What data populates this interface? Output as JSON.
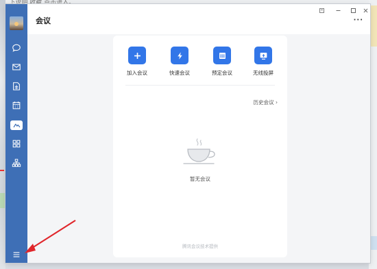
{
  "background": {
    "top_text": "...     下说明      收藏     点击进入。"
  },
  "window": {
    "title": "会议",
    "controls": {
      "pin_icon": "pin-icon",
      "minimize_icon": "minimize-icon",
      "maximize_icon": "maximize-icon",
      "close_icon": "close-icon"
    },
    "more_label": "···"
  },
  "sidebar": {
    "items": [
      {
        "name": "chat",
        "icon": "chat-bubble-icon"
      },
      {
        "name": "mail",
        "icon": "mail-icon"
      },
      {
        "name": "docs",
        "icon": "docs-icon"
      },
      {
        "name": "calendar",
        "icon": "calendar-icon"
      },
      {
        "name": "meeting",
        "icon": "meeting-icon",
        "active": true
      },
      {
        "name": "workbench",
        "icon": "apps-grid-icon"
      },
      {
        "name": "contacts",
        "icon": "org-chart-icon"
      }
    ],
    "menu_icon": "hamburger-menu-icon"
  },
  "meeting": {
    "actions": [
      {
        "label": "加入会议",
        "icon": "plus-icon"
      },
      {
        "label": "快速会议",
        "icon": "lightning-icon"
      },
      {
        "label": "预定会议",
        "icon": "calendar-grid-icon"
      },
      {
        "label": "无线投屏",
        "icon": "screen-cast-icon"
      }
    ],
    "history_label": "历史会议 ›",
    "empty_text": "暂无会议",
    "footer_text": "腾讯会议技术提供"
  },
  "colors": {
    "sidebar_bg": "#3e6fb6",
    "accent": "#3276e8",
    "annotation_arrow": "#e0262b"
  }
}
